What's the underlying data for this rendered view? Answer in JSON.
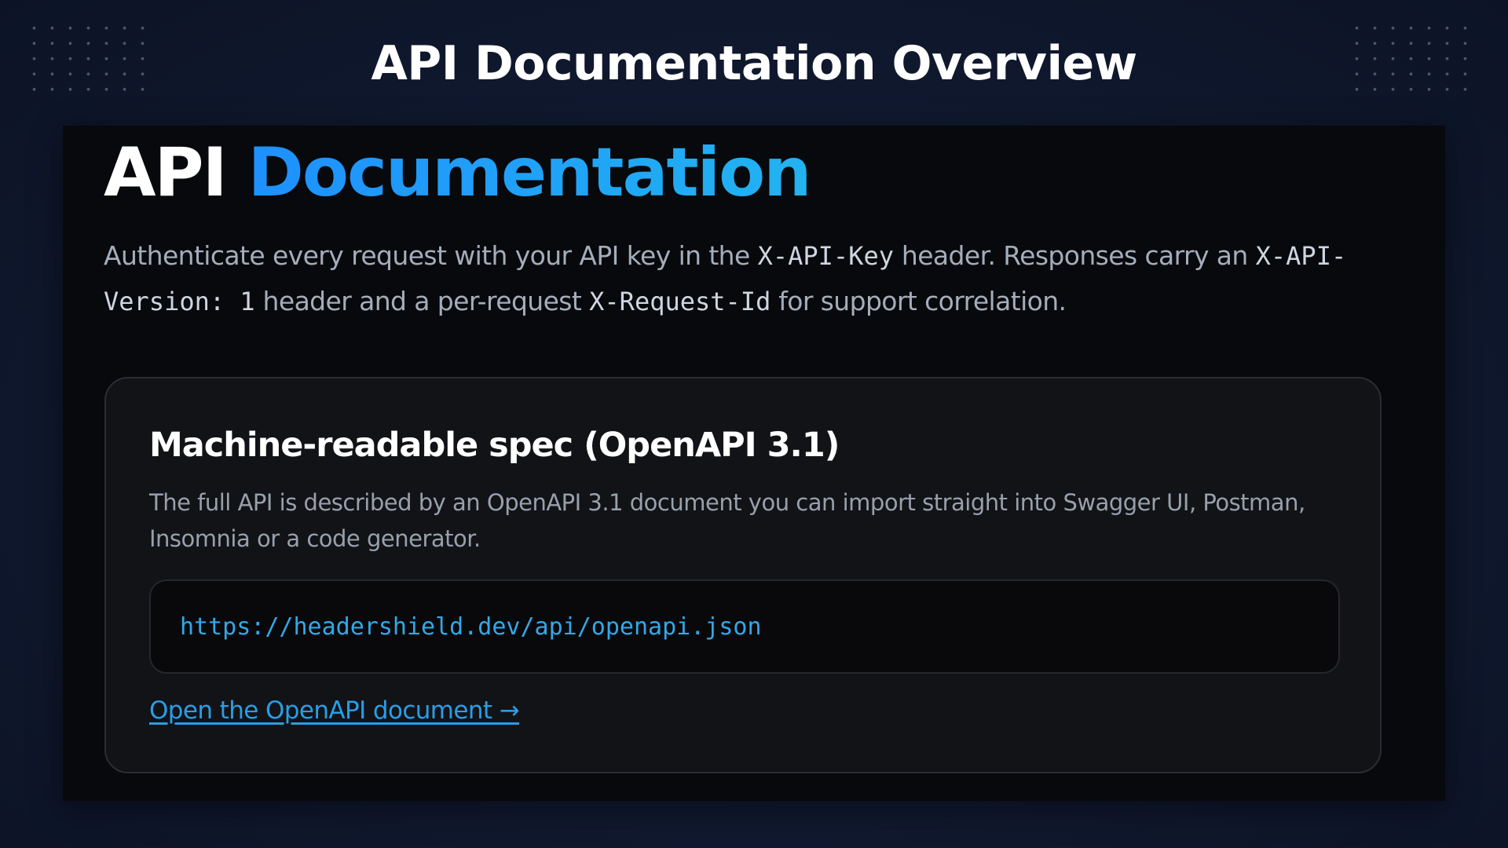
{
  "slide": {
    "title": "API Documentation Overview"
  },
  "doc": {
    "heading_part1": "API",
    "heading_part2": "Documentation",
    "intro": {
      "t1": "Authenticate every request with your API key in the ",
      "c1": "X-API-Key",
      "t2": " header. Responses carry an ",
      "c2": "X-API-Version: 1",
      "t3": " header and a per-request ",
      "c3": "X-Request-Id",
      "t4": " for support correlation."
    }
  },
  "spec_card": {
    "title": "Machine-readable spec (OpenAPI 3.1)",
    "description": "The full API is described by an OpenAPI 3.1 document you can import straight into Swagger UI, Postman, Insomnia or a code generator.",
    "url": "https://headershield.dev/api/openapi.json",
    "link_label": "Open the OpenAPI document →"
  },
  "colors": {
    "accent": "#1e90ff",
    "link": "#2a9de6",
    "background": "#111a31"
  }
}
